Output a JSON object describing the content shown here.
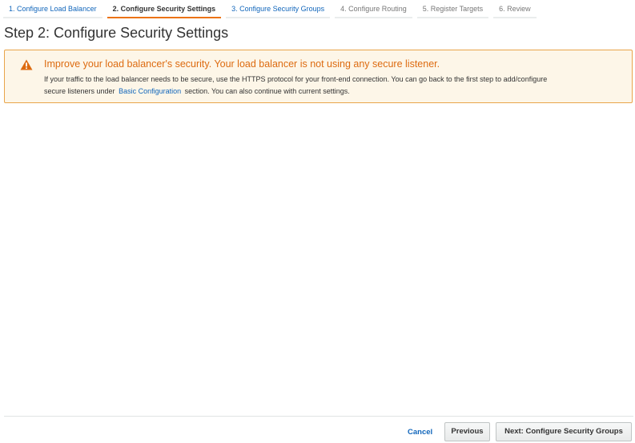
{
  "wizard": {
    "steps": [
      {
        "label": "1. Configure Load Balancer",
        "state": "done"
      },
      {
        "label": "2. Configure Security Settings",
        "state": "active"
      },
      {
        "label": "3. Configure Security Groups",
        "state": "next"
      },
      {
        "label": "4. Configure Routing",
        "state": "future"
      },
      {
        "label": "5. Register Targets",
        "state": "future"
      },
      {
        "label": "6. Review",
        "state": "future"
      }
    ]
  },
  "page": {
    "title": "Step 2: Configure Security Settings"
  },
  "alert": {
    "icon": "warning-icon",
    "title": "Improve your load balancer's security. Your load balancer is not using any secure listener.",
    "body_line1": "If your traffic to the load balancer needs to be secure, use the HTTPS protocol for your front-end connection. You can go back to the first step to add/configure",
    "body_line2_prefix": "secure listeners under",
    "body_link": "Basic Configuration",
    "body_line2_suffix": "section. You can also continue with current settings.",
    "colors": {
      "border": "#e9a54a",
      "background": "#fdf6e8",
      "title": "#dd6b10"
    }
  },
  "footer": {
    "cancel_label": "Cancel",
    "previous_label": "Previous",
    "next_label": "Next: Configure Security Groups"
  },
  "colors": {
    "link": "#1166bb",
    "accent": "#ec7211"
  }
}
